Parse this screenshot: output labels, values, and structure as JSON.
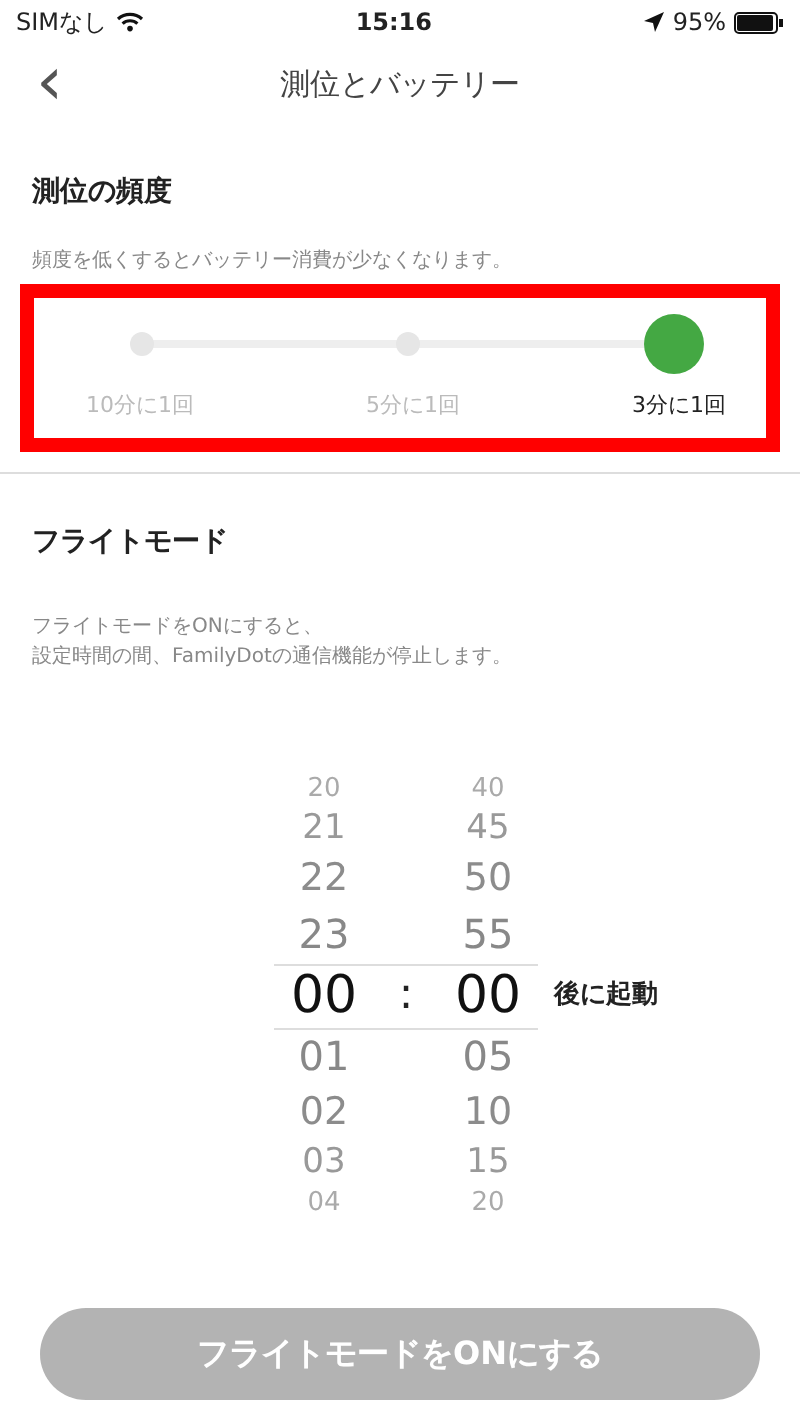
{
  "status_bar": {
    "carrier": "SIMなし",
    "time": "15:16",
    "battery": "95%"
  },
  "header": {
    "back": "‹",
    "title": "測位とバッテリー"
  },
  "frequency": {
    "title": "測位の頻度",
    "description": "頻度を低くするとバッテリー消費が少なくなります。",
    "highlighted": true,
    "options": [
      {
        "label": "10分に1回",
        "selected": false
      },
      {
        "label": "5分に1回",
        "selected": false
      },
      {
        "label": "3分に1回",
        "selected": true
      }
    ]
  },
  "flight_mode": {
    "title": "フライトモード",
    "description_lines": [
      "フライトモードをONにすると、",
      "設定時間の間、FamilyDotの通信機能が停止します。"
    ],
    "picker": {
      "hours": [
        {
          "value": "20",
          "selected": false
        },
        {
          "value": "21",
          "selected": false
        },
        {
          "value": "22",
          "selected": false
        },
        {
          "value": "23",
          "selected": false
        },
        {
          "value": "00",
          "selected": true
        },
        {
          "value": "01",
          "selected": false
        },
        {
          "value": "02",
          "selected": false
        },
        {
          "value": "03",
          "selected": false
        },
        {
          "value": "04",
          "selected": false
        }
      ],
      "separator": ":",
      "minutes": [
        {
          "value": "40",
          "selected": false
        },
        {
          "value": "45",
          "selected": false
        },
        {
          "value": "50",
          "selected": false
        },
        {
          "value": "55",
          "selected": false
        },
        {
          "value": "00",
          "selected": true
        },
        {
          "value": "05",
          "selected": false
        },
        {
          "value": "10",
          "selected": false
        },
        {
          "value": "15",
          "selected": false
        },
        {
          "value": "20",
          "selected": false
        }
      ],
      "suffix": "後に起動"
    },
    "button": {
      "label": "フライトモードをONにする",
      "disabled": true
    }
  }
}
